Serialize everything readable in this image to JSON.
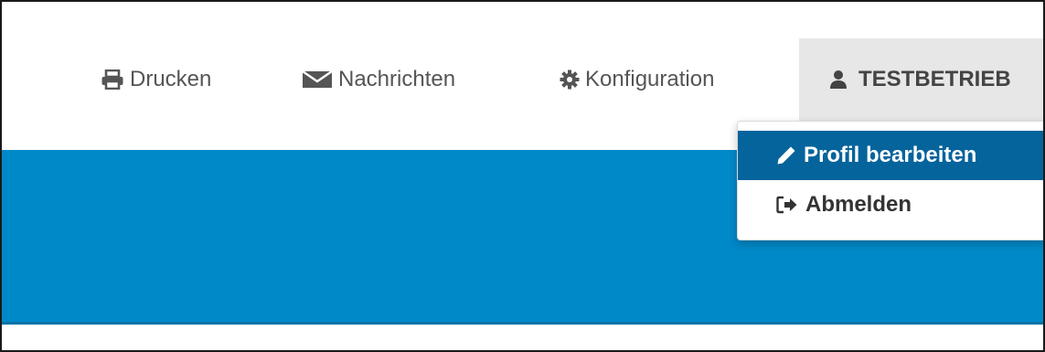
{
  "nav": {
    "print": {
      "label": "Drucken",
      "icon": "print-icon"
    },
    "messages": {
      "label": "Nachrichten",
      "icon": "envelope-icon"
    },
    "config": {
      "label": "Konfiguration",
      "icon": "gear-icon"
    },
    "account": {
      "label": "TESTBETRIEB",
      "icon": "user-icon"
    }
  },
  "account_menu": {
    "items": [
      {
        "label": "Profil bearbeiten",
        "icon": "pencil-icon",
        "active": true
      },
      {
        "label": "Abmelden",
        "icon": "sign-out-icon",
        "active": false
      }
    ]
  },
  "colors": {
    "hero": "#0089c9",
    "active_item": "#05649c",
    "nav_text": "#555555",
    "account_bg": "#e7e7e7"
  }
}
